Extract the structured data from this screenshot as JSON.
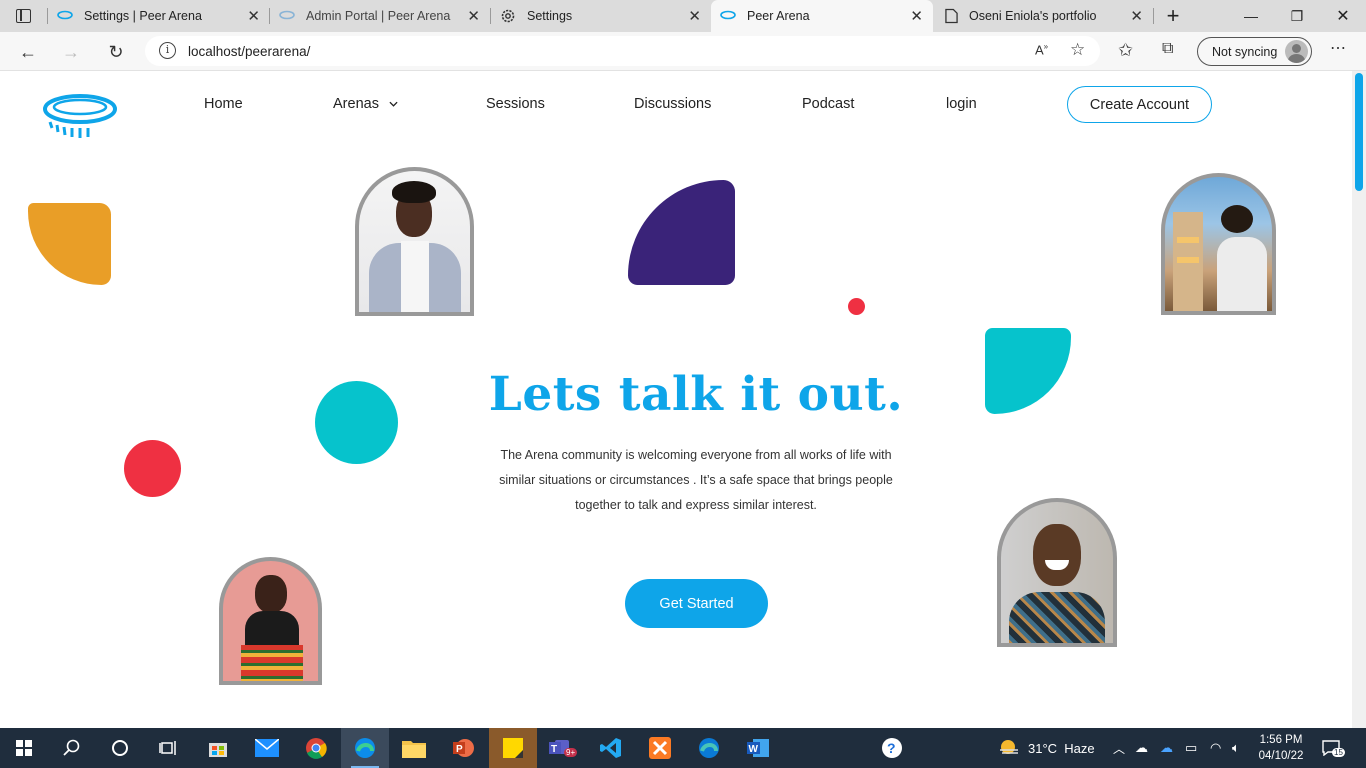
{
  "browser": {
    "tabs": [
      {
        "title": "Settings | Peer Arena"
      },
      {
        "title": "Admin Portal | Peer Arena"
      },
      {
        "title": "Settings"
      },
      {
        "title": "Peer Arena"
      },
      {
        "title": "Oseni Eniola's portfolio"
      }
    ],
    "url": "localhost/peerarena/",
    "sync_label": "Not syncing",
    "colors": {
      "accent": "#0ea5e9"
    }
  },
  "site": {
    "nav": {
      "home": "Home",
      "arenas": "Arenas",
      "sessions": "Sessions",
      "discussions": "Discussions",
      "podcast": "Podcast",
      "login": "login",
      "create_account": "Create Account"
    },
    "hero": {
      "title": "Lets talk it out.",
      "description": "The Arena community is welcoming everyone from all works of life with similar situations or circumstances . It’s a safe space that brings people together to talk and express similar interest.",
      "cta": "Get Started"
    },
    "colors": {
      "orange": "#e99e27",
      "purple": "#3a2379",
      "red": "#ef3042",
      "teal": "#06c3cc"
    }
  },
  "taskbar": {
    "weather": "31°C  Haze",
    "time": "1:56 PM",
    "date": "04/10/22",
    "notifications": "15",
    "teams_badge": "9+"
  }
}
